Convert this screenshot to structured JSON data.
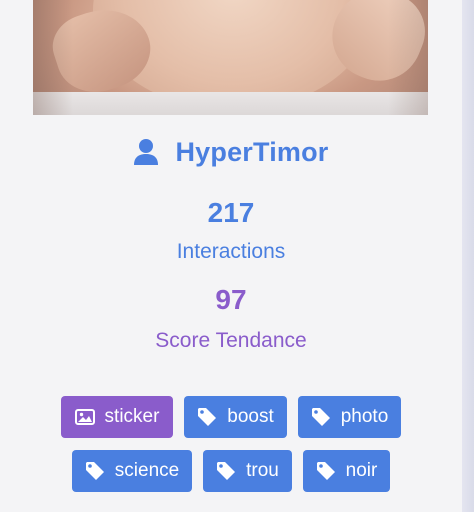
{
  "profile": {
    "username": "HyperTimor",
    "user_icon": "user-icon"
  },
  "stats": {
    "interactions": {
      "value": "217",
      "label": "Interactions"
    },
    "trend_score": {
      "value": "97",
      "label": "Score Tendance"
    }
  },
  "tags": [
    {
      "label": "sticker",
      "icon": "image-icon",
      "color": "#8a5ccb"
    },
    {
      "label": "boost",
      "icon": "tag-icon",
      "color": "#4a7fe0"
    },
    {
      "label": "photo",
      "icon": "tag-icon",
      "color": "#4a7fe0"
    },
    {
      "label": "science",
      "icon": "tag-icon",
      "color": "#4a7fe0"
    },
    {
      "label": "trou",
      "icon": "tag-icon",
      "color": "#4a7fe0"
    },
    {
      "label": "noir",
      "icon": "tag-icon",
      "color": "#4a7fe0"
    }
  ],
  "colors": {
    "accent_blue": "#4a7fe0",
    "accent_purple": "#8a5ccb",
    "background": "#f4f4f6"
  }
}
